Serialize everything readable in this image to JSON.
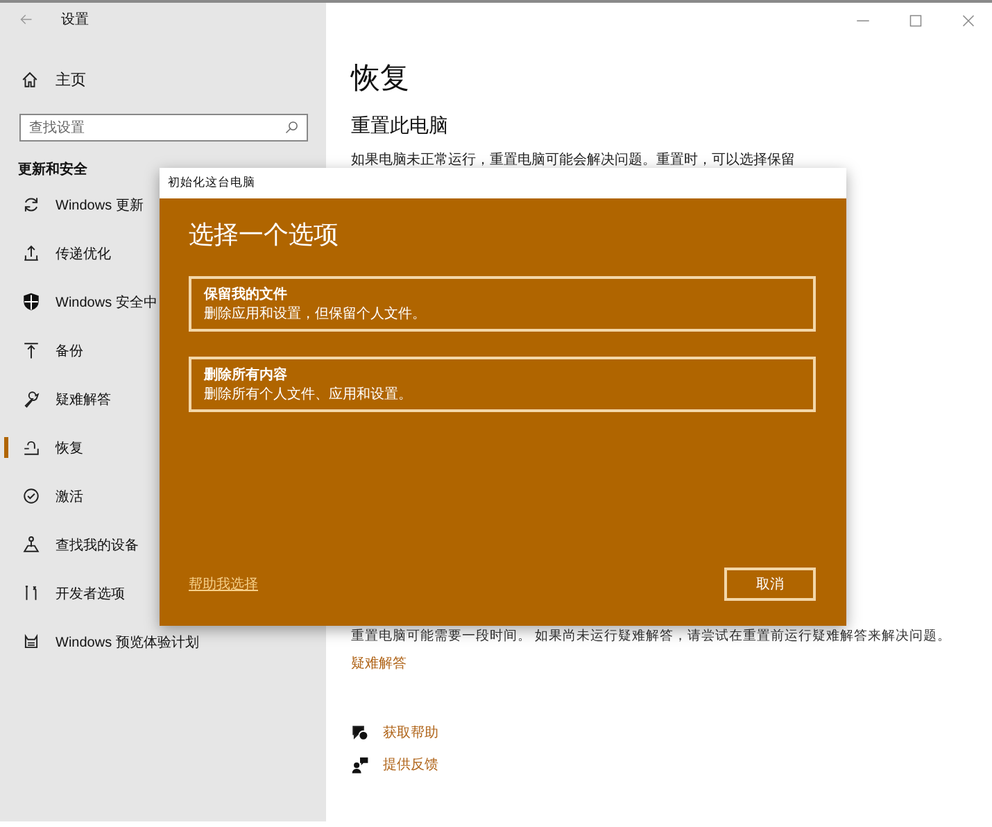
{
  "window": {
    "title": "设置"
  },
  "sidebar": {
    "home": "主页",
    "search": {
      "placeholder": "查找设置"
    },
    "section": "更新和安全",
    "items": [
      {
        "label": "Windows 更新",
        "selected": false
      },
      {
        "label": "传递优化",
        "selected": false
      },
      {
        "label": "Windows 安全中",
        "selected": false
      },
      {
        "label": "备份",
        "selected": false
      },
      {
        "label": "疑难解答",
        "selected": false
      },
      {
        "label": "恢复",
        "selected": true
      },
      {
        "label": "激活",
        "selected": false
      },
      {
        "label": "查找我的设备",
        "selected": false
      },
      {
        "label": "开发者选项",
        "selected": false
      },
      {
        "label": "Windows 预览体验计划",
        "selected": false
      }
    ]
  },
  "main": {
    "title": "恢复",
    "heading": "重置此电脑",
    "description": "如果电脑未正常运行，重置电脑可能会解决问题。重置时，可以选择保留",
    "note": "重置电脑可能需要一段时间。 如果尚未运行疑难解答，请尝试在重置前运行疑难解答来解决问题。",
    "note_link": "疑难解答",
    "links": [
      "获取帮助",
      "提供反馈"
    ]
  },
  "dialog": {
    "title": "初始化这台电脑",
    "heading": "选择一个选项",
    "options": [
      {
        "title": "保留我的文件",
        "description": "删除应用和设置，但保留个人文件。"
      },
      {
        "title": "删除所有内容",
        "description": "删除所有个人文件、应用和设置。"
      }
    ],
    "help_link": "帮助我选择",
    "cancel": "取消"
  }
}
